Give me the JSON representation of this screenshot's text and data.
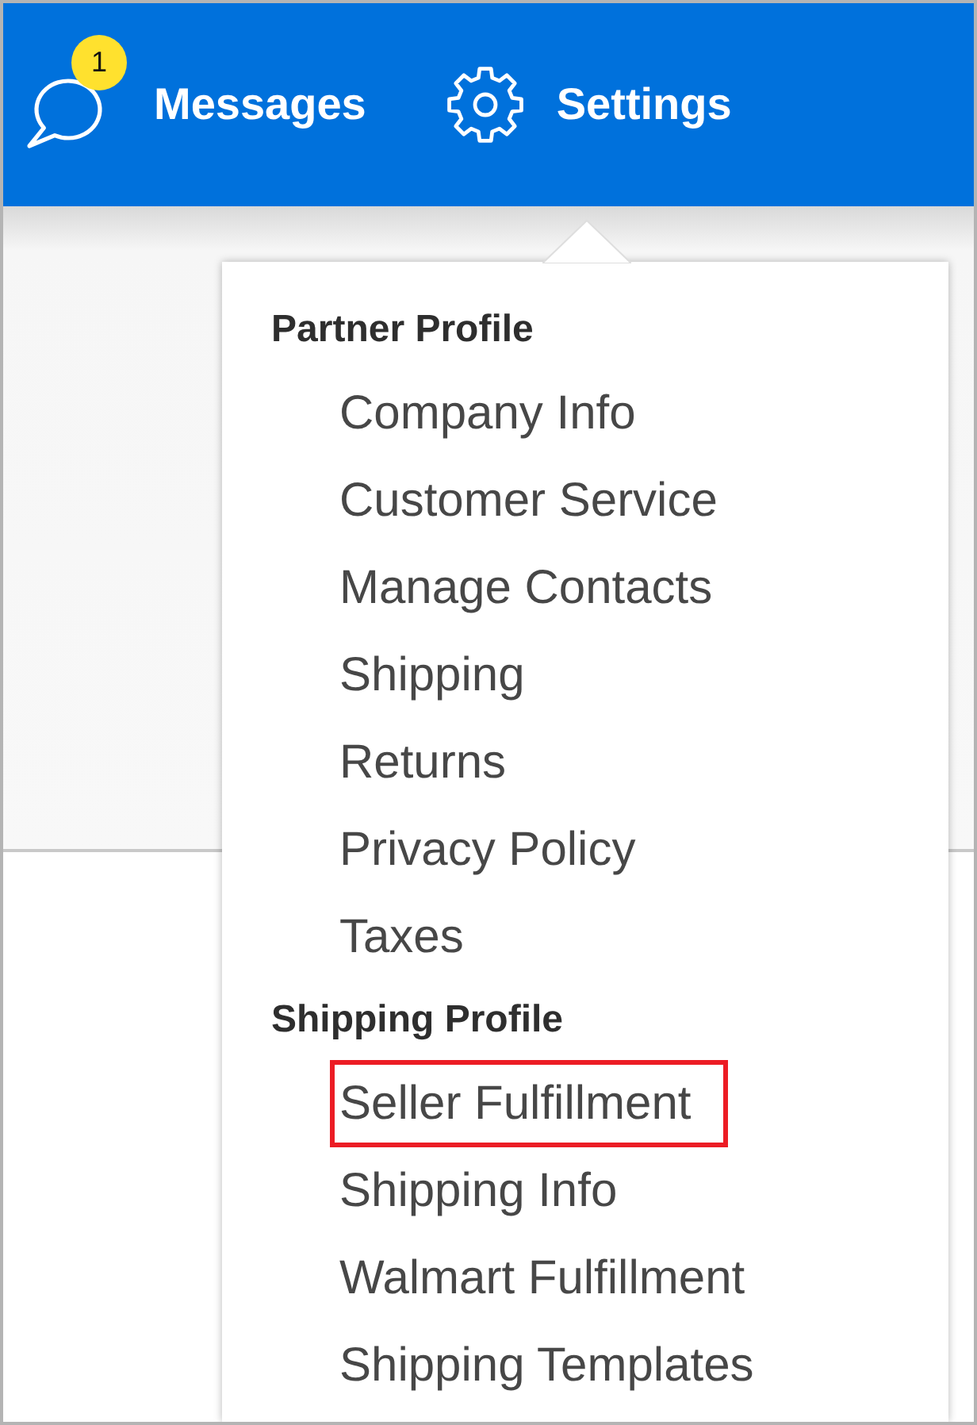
{
  "top_bar": {
    "messages": {
      "label": "Messages",
      "badge": "1"
    },
    "settings": {
      "label": "Settings"
    }
  },
  "settings_menu": {
    "sections": [
      {
        "heading": "Partner Profile",
        "items": [
          {
            "label": "Company Info",
            "highlighted": false
          },
          {
            "label": "Customer Service",
            "highlighted": false
          },
          {
            "label": "Manage Contacts",
            "highlighted": false
          },
          {
            "label": "Shipping",
            "highlighted": false
          },
          {
            "label": "Returns",
            "highlighted": false
          },
          {
            "label": "Privacy Policy",
            "highlighted": false
          },
          {
            "label": "Taxes",
            "highlighted": false
          }
        ]
      },
      {
        "heading": "Shipping Profile",
        "items": [
          {
            "label": "Seller Fulfillment",
            "highlighted": true
          },
          {
            "label": "Shipping Info",
            "highlighted": false
          },
          {
            "label": "Walmart Fulfillment",
            "highlighted": false
          },
          {
            "label": "Shipping Templates",
            "highlighted": false
          }
        ]
      }
    ]
  }
}
